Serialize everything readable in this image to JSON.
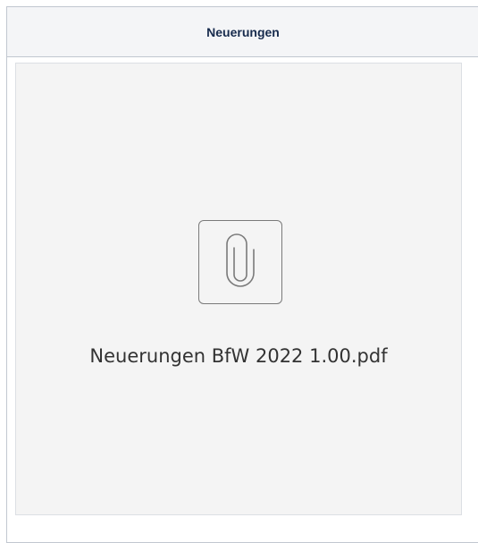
{
  "panel": {
    "title": "Neuerungen"
  },
  "attachment": {
    "file_name": "Neuerungen BfW 2022 1.00.pdf",
    "icon": "paperclip-icon"
  }
}
